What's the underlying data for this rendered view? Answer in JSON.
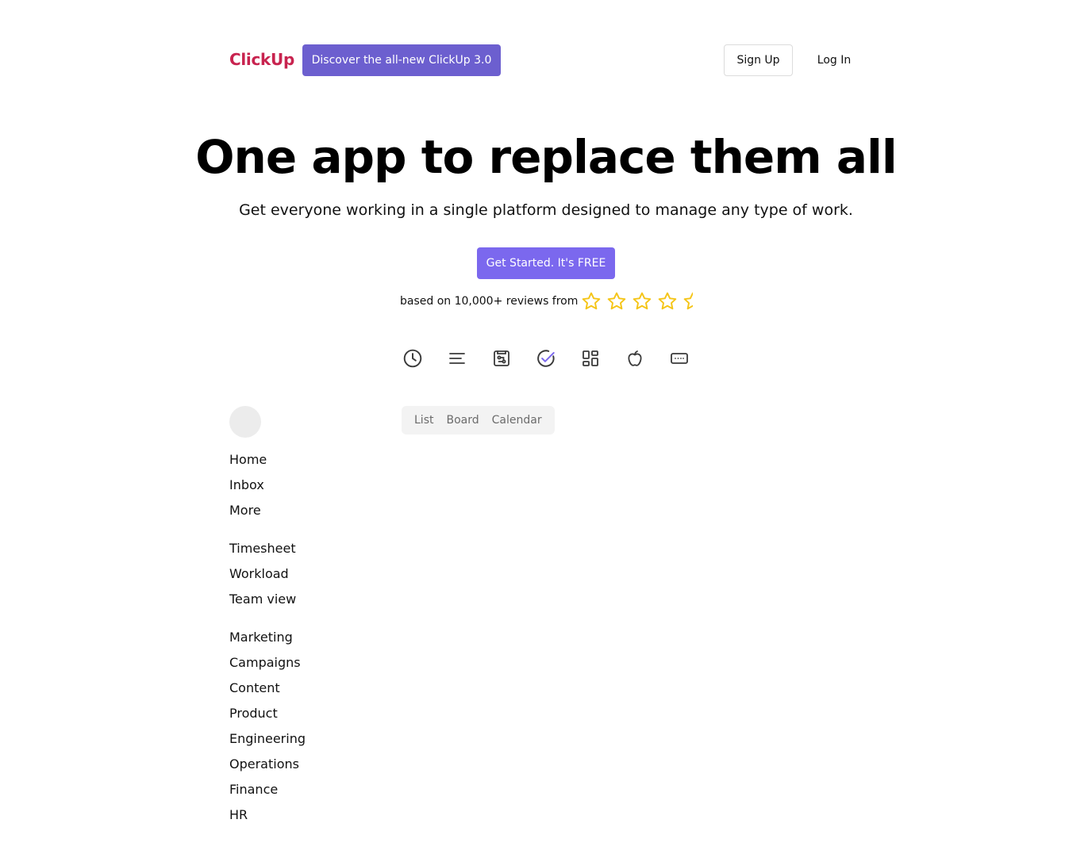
{
  "header": {
    "brand": "ClickUp",
    "promo_label": "Discover the all-new ClickUp 3.0",
    "signup_label": "Sign Up",
    "login_label": "Log In"
  },
  "hero": {
    "title": "One app to replace them all",
    "subtitle": "Get everyone working in a single platform designed to manage any type of work.",
    "cta_label": "Get Started. It's FREE",
    "reviews_text": "based on 10,000+ reviews from",
    "rating": 4.5,
    "rating_max": 5,
    "star_color": "#f5c518"
  },
  "feature_icons": [
    {
      "name": "clock-icon"
    },
    {
      "name": "align-left-icon"
    },
    {
      "name": "whiteboard-icon"
    },
    {
      "name": "check-circle-icon"
    },
    {
      "name": "dashboard-icon"
    },
    {
      "name": "apple-icon"
    },
    {
      "name": "keyboard-icon"
    }
  ],
  "sidebar": {
    "groups": [
      {
        "items": [
          "Home",
          "Inbox",
          "More"
        ]
      },
      {
        "items": [
          "Timesheet",
          "Workload",
          "Team view"
        ]
      },
      {
        "items": [
          "Marketing",
          "Campaigns",
          "Content",
          "Product",
          "Engineering",
          "Operations",
          "Finance",
          "HR"
        ]
      }
    ]
  },
  "view_tabs": [
    "List",
    "Board",
    "Calendar"
  ],
  "colors": {
    "brand": "#c8234f",
    "promo": "#6c5fcf",
    "cta": "#7b68ee",
    "check_accent": "#7b68ee"
  }
}
